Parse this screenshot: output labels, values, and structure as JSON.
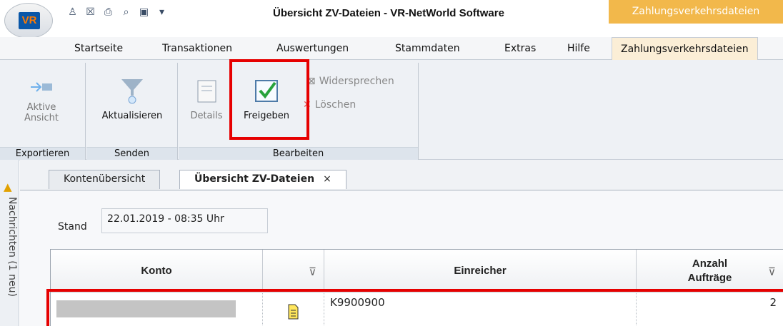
{
  "window": {
    "title": "Übersicht ZV-Dateien - VR-NetWorld Software",
    "context_tab": "Zahlungsverkehrsdateien",
    "logo_text": "VR",
    "quick_access_icons": [
      "user-icon",
      "security-icon",
      "print-icon",
      "preview-icon",
      "export-icon",
      "dropdown-icon"
    ]
  },
  "menu": [
    "Startseite",
    "Transaktionen",
    "Auswertungen",
    "Stammdaten",
    "Extras",
    "Hilfe",
    "Zahlungsverkehrsdateien"
  ],
  "ribbon": {
    "groups": {
      "exportieren": {
        "label": "Exportieren",
        "button": "Aktive Ansicht"
      },
      "senden": {
        "label": "Senden",
        "button": "Aktualisieren"
      },
      "bearbeiten": {
        "label": "Bearbeiten",
        "details": "Details",
        "freigeben": "Freigeben",
        "widersprechen": "Widersprechen",
        "loeschen": "Löschen"
      }
    }
  },
  "sidebar": {
    "messages": "Nachrichten (1 neu)"
  },
  "tabs": {
    "first": "Kontenübersicht",
    "active": "Übersicht ZV-Dateien",
    "close": "×"
  },
  "stand": {
    "label": "Stand",
    "value": "22.01.2019 - 08:35 Uhr"
  },
  "grid": {
    "headers": {
      "konto": "Konto",
      "einreicher": "Einreicher",
      "anzahl_line1": "Anzahl",
      "anzahl_line2": "Aufträge"
    },
    "rows": [
      {
        "einreicher": "K9900900",
        "anzahl": "2",
        "status_icon": "document-icon"
      }
    ]
  },
  "colors": {
    "accent_orange": "#f2b84b",
    "highlight_red": "#e60000",
    "ribbon_bg": "#eef1f5"
  }
}
